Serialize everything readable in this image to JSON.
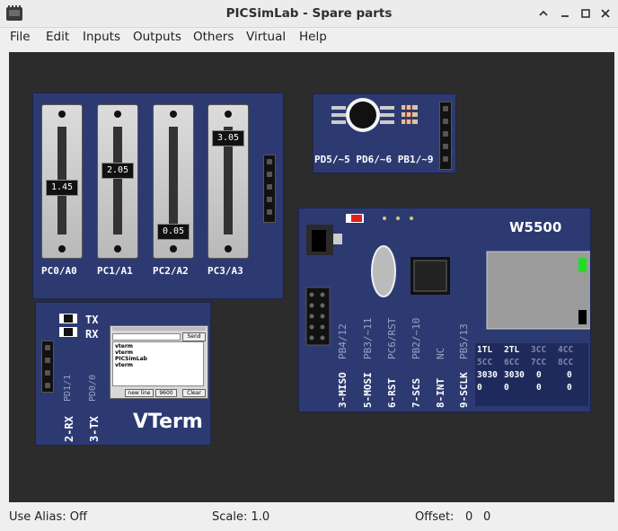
{
  "window": {
    "title": "PICSimLab - Spare parts"
  },
  "menu": [
    "File",
    "Edit",
    "Inputs",
    "Outputs",
    "Others",
    "Virtual",
    "Help"
  ],
  "pots": {
    "items": [
      {
        "label": "PC0/A0",
        "value": "1.45",
        "level": 0.45
      },
      {
        "label": "PC1/A1",
        "value": "2.05",
        "level": 0.62
      },
      {
        "label": "PC2/A2",
        "value": "0.05",
        "level": 0.0
      },
      {
        "label": "PC3/A3",
        "value": "3.05",
        "level": 0.95
      }
    ]
  },
  "rgb": {
    "label": "PD5/~5 PD6/~6 PB1/~9"
  },
  "w5500": {
    "title": "W5500",
    "pins": [
      {
        "name": "3-MISO",
        "port": "PB4/12"
      },
      {
        "name": "5-MOSI",
        "port": "PB3/~11"
      },
      {
        "name": "6-RST",
        "port": "PC6/RST"
      },
      {
        "name": "7-SCS",
        "port": "PB2/~10"
      },
      {
        "name": "8-INT",
        "port": "NC"
      },
      {
        "name": "9-SCLK",
        "port": "PB5/13"
      }
    ],
    "table": {
      "row1": [
        "1TL",
        "2TL",
        "3CC",
        "4CC"
      ],
      "row2": [
        "5CC",
        "6CC",
        "7CC",
        "8CC"
      ],
      "row3": [
        "3030",
        "3030",
        "0",
        "0"
      ],
      "row4": [
        "0",
        "0",
        "0",
        "0"
      ]
    }
  },
  "vterm": {
    "title": "VTerm",
    "tx": "TX",
    "rx": "RX",
    "pins": [
      {
        "name": "2-RX",
        "port": "PD1/1"
      },
      {
        "name": "3-TX",
        "port": "PD0/0"
      }
    ],
    "window": {
      "send_label": "Send",
      "lines": [
        "vterm",
        "vterm",
        "PICSimLab",
        "vterm"
      ],
      "newline_label": "new line",
      "baud_label": "9600",
      "clear_label": "Clear"
    }
  },
  "status": {
    "alias": "Use Alias: Off",
    "scale": "Scale: 1.0",
    "offset_label": "Offset:",
    "offset_x": "0",
    "offset_y": "0"
  },
  "colors": {
    "pcb": "#2d3a72",
    "canvas": "#2c2c2c",
    "led_red": "#e02020",
    "led_green": "#22dd22"
  }
}
